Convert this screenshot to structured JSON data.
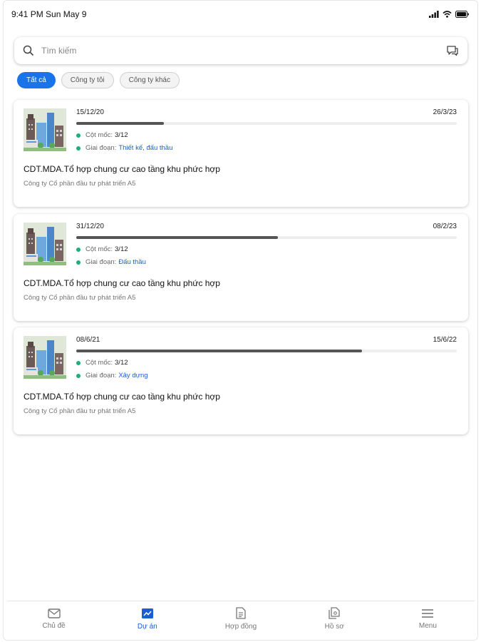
{
  "status_bar": {
    "time_date": "9:41 PM  Sun May 9"
  },
  "search": {
    "placeholder": "Tìm kiếm"
  },
  "filters": [
    {
      "label": "Tất cả",
      "active": true
    },
    {
      "label": "Công ty tôi",
      "active": false
    },
    {
      "label": "Công ty khác",
      "active": false
    }
  ],
  "projects": [
    {
      "start_date": "15/12/20",
      "end_date": "26/3/23",
      "progress": 0.23,
      "milestone_label": "Cột mốc:",
      "milestone_value": "3/12",
      "phase_label": "Giai đoạn:",
      "phase_value": "Thiết kế, đấu thầu",
      "title": "CDT.MDA.Tổ hợp chung cư cao tầng khu phức hợp",
      "company": "Công ty Cổ phần đầu tư phát triển A5"
    },
    {
      "start_date": "31/12/20",
      "end_date": "08/2/23",
      "progress": 0.53,
      "milestone_label": "Cột mốc:",
      "milestone_value": "3/12",
      "phase_label": "Giai đoạn:",
      "phase_value": "Đấu thầu",
      "title": "CDT.MDA.Tổ hợp chung cư cao tầng khu phức hợp",
      "company": "Công ty Cổ phần đầu tư phát triển A5"
    },
    {
      "start_date": "08/6/21",
      "end_date": "15/6/22",
      "progress": 0.75,
      "milestone_label": "Cột mốc:",
      "milestone_value": "3/12",
      "phase_label": "Giai đoạn:",
      "phase_value": "Xây dựng",
      "title": "CDT.MDA.Tổ hợp chung cư cao tầng khu phức hợp",
      "company": "Công ty Cổ phần đầu tư phát triển A5"
    }
  ],
  "tabbar": [
    {
      "label": "Chủ đề",
      "icon": "mail-icon",
      "active": false
    },
    {
      "label": "Dự án",
      "icon": "project-chart-icon",
      "active": true
    },
    {
      "label": "Hợp đồng",
      "icon": "contract-document-icon",
      "active": false
    },
    {
      "label": "Hồ sơ",
      "icon": "files-icon",
      "active": false
    },
    {
      "label": "Menu",
      "icon": "menu-icon",
      "active": false
    }
  ],
  "colors": {
    "accent": "#1a73e8",
    "link": "#1a5fd1",
    "dot": "#19b07a",
    "progress": "#555555"
  }
}
